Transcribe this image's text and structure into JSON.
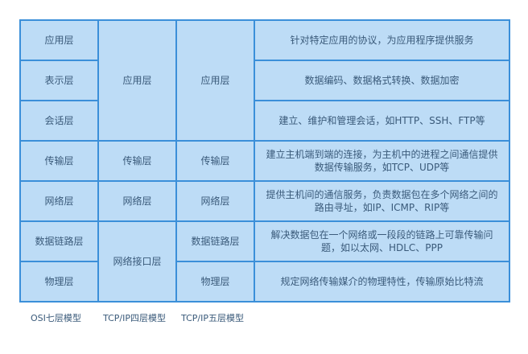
{
  "table": {
    "rows": [
      {
        "osi": "应用层",
        "tcp4": "应用层",
        "tcp5": "应用层",
        "desc": "针对特定应用的协议，为应用程序提供服务"
      },
      {
        "osi": "表示层",
        "desc": "数据编码、数据格式转换、数据加密"
      },
      {
        "osi": "会话层",
        "desc": "建立、维护和管理会话，如HTTP、SSH、FTP等"
      },
      {
        "osi": "传输层",
        "tcp4": "传输层",
        "tcp5": "传输层",
        "desc": "建立主机端到端的连接，为主机中的进程之间通信提供数据传输服务，如TCP、UDP等"
      },
      {
        "osi": "网络层",
        "tcp4": "网络层",
        "tcp5": "网络层",
        "desc": "提供主机间的通信服务，负责数据包在多个网络之间的路由寻址，如IP、ICMP、RIP等"
      },
      {
        "osi": "数据链路层",
        "tcp4": "网络接口层",
        "tcp5": "数据链路层",
        "desc": "解决数据包在一个网络或一段段的链路上可靠传输问题，如以太网、HDLC、PPP"
      },
      {
        "osi": "物理层",
        "tcp5": "物理层",
        "desc": "规定网络传输媒介的物理特性，传输原始比特流"
      }
    ]
  },
  "captions": {
    "osi": "OSI七层模型",
    "tcp4": "TCP/IP四层模型",
    "tcp5": "TCP/IP五层模型"
  }
}
